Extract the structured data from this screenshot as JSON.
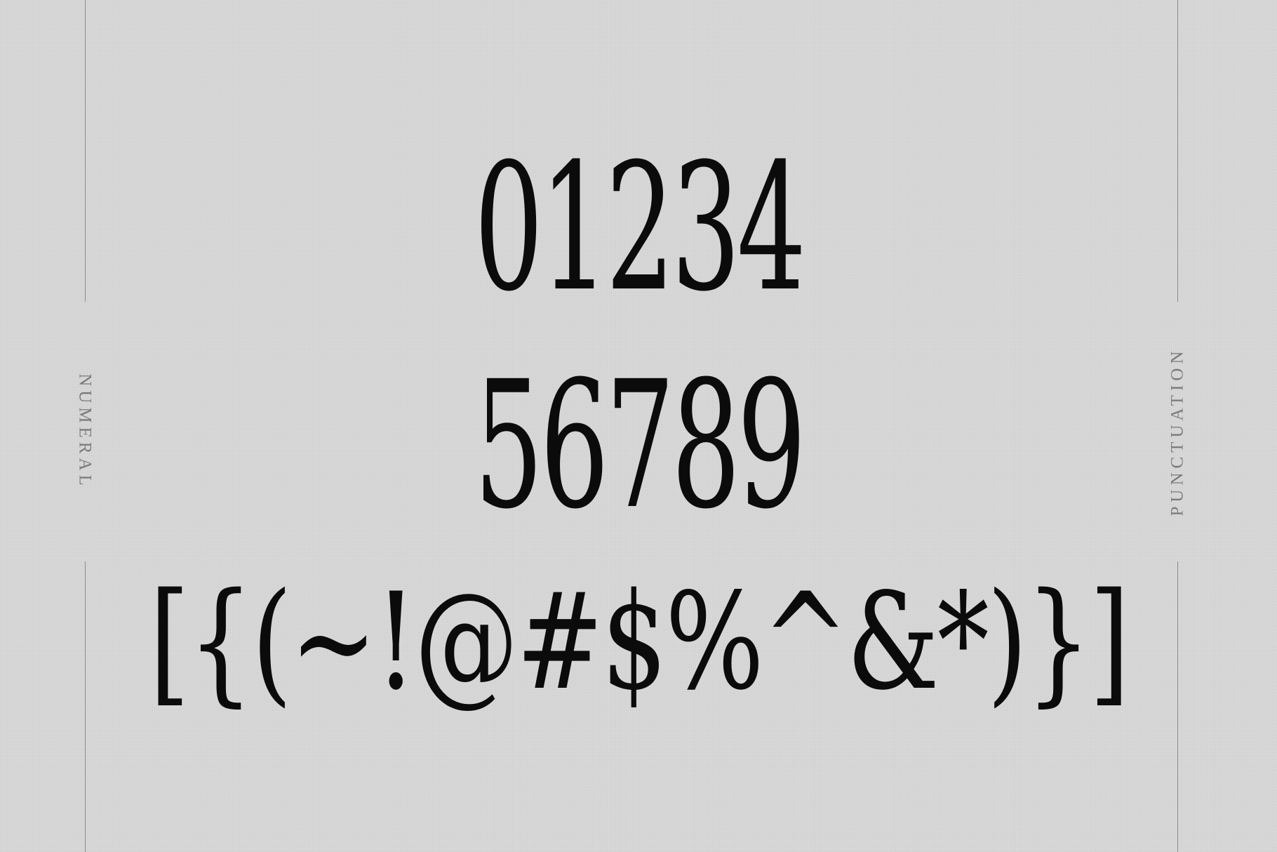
{
  "labels": {
    "left": "NUMERAL",
    "right": "PUNCTUATION"
  },
  "specimen": {
    "digits_row_1": "01234",
    "digits_row_2": "56789",
    "punctuation_row": "[{(~!@#$%^&*)}]"
  },
  "colors": {
    "background": "#d8d8d8",
    "glyph": "#0b0b0b",
    "label": "#7a7a7a",
    "rule": "#8a8a8a"
  }
}
